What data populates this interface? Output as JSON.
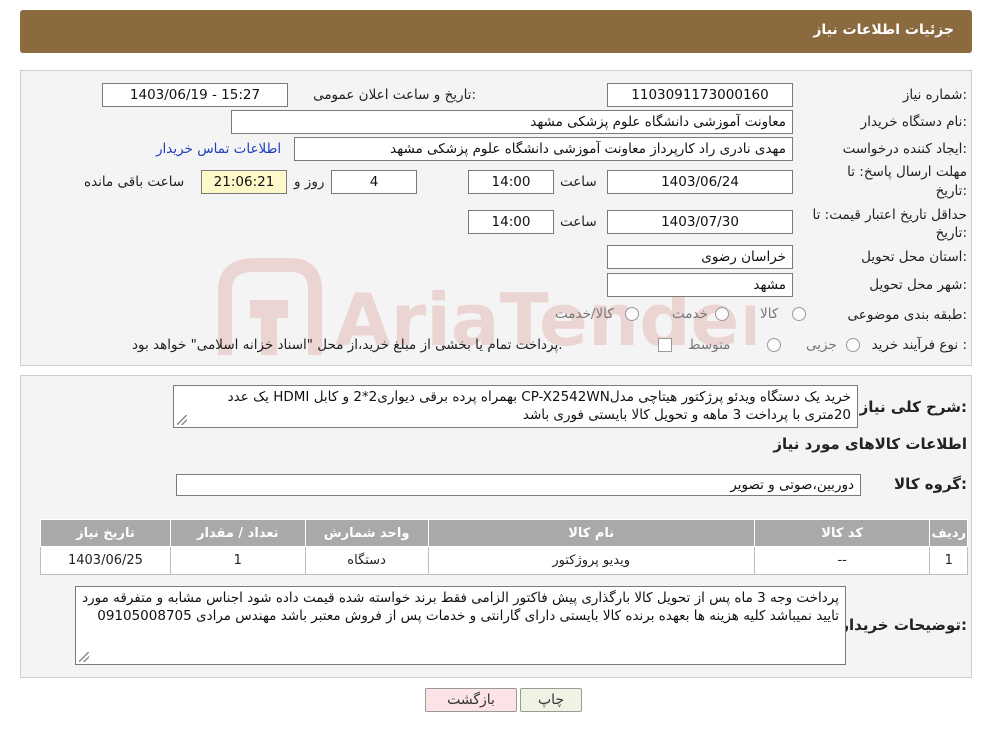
{
  "header": {
    "title": "جزئیات اطلاعات نیاز"
  },
  "form": {
    "need_number": {
      "label": "شماره نیاز:",
      "value": "1103091173000160"
    },
    "announce_datetime": {
      "label": "تاریخ و ساعت اعلان عمومی:",
      "value": "1403/06/19 - 15:27"
    },
    "buyer_org": {
      "label": "نام دستگاه خریدار:",
      "value": "معاونت آموزشی دانشگاه علوم پزشکی مشهد"
    },
    "requester": {
      "label": "ایجاد کننده درخواست:",
      "value": "مهدی نادری راد کارپرداز معاونت آموزشی دانشگاه علوم پزشکی مشهد",
      "contact_link": "اطلاعات تماس خریدار"
    },
    "reply_deadline": {
      "label_line1": "مهلت ارسال پاسخ: تا",
      "label_line2": "تاریخ:",
      "date": "1403/06/24",
      "time_label": "ساعت",
      "time": "14:00",
      "days": "4",
      "days_label": "روز و",
      "remaining": "21:06:21",
      "remaining_label": "ساعت باقی مانده"
    },
    "price_validity": {
      "label_line1": "حداقل تاریخ اعتبار قیمت: تا",
      "label_line2": "تاریخ:",
      "date": "1403/07/30",
      "time_label": "ساعت",
      "time": "14:00"
    },
    "province": {
      "label": "استان محل تحویل:",
      "value": "خراسان رضوی"
    },
    "city": {
      "label": "شهر محل تحویل:",
      "value": "مشهد"
    },
    "category": {
      "label": "طبقه بندی موضوعی:",
      "options": [
        "کالا",
        "خدمت",
        "کالا/خدمت"
      ]
    },
    "purchase_type": {
      "label": "نوع فرآیند خرید :",
      "options": [
        "جزیی",
        "متوسط"
      ],
      "note": "پرداخت تمام یا بخشی از مبلغ خرید،از محل \"اسناد خزانه اسلامی\" خواهد بود."
    }
  },
  "description": {
    "label": "شرح کلی نیاز:",
    "text": "خرید یک دستگاه ویدئو پرژکتور هیتاچی مدلCP-X2542WN  بهمراه پرده برقی دیواری2*2 و کابل HDMI یک عدد 20متری با پرداخت 3 ماهه و تحویل کالا بایستی فوری باشد"
  },
  "items_section": {
    "title": "اطلاعات کالاهای مورد نیاز"
  },
  "goods_group": {
    "label": "گروه کالا:",
    "value": "دوربین،صوتی و تصویر"
  },
  "table": {
    "headers": [
      "ردیف",
      "کد کالا",
      "نام کالا",
      "واحد شمارش",
      "تعداد / مقدار",
      "تاریخ نیاز"
    ],
    "rows": [
      {
        "row": "1",
        "code": "--",
        "name": "ویدیو پروژکتور",
        "unit": "دستگاه",
        "qty": "1",
        "date": "1403/06/25"
      }
    ]
  },
  "buyer_notes": {
    "label": "توضیحات خریدار:",
    "text": "پرداخت وجه 3 ماه پس از تحویل کالا بارگذاری پیش فاکتور الزامی فقط برند خواسته شده قیمت داده شود اجناس مشابه و متفرقه مورد تایید نمیباشد کلیه هزینه ها بعهده برنده کالا بایستی دارای گارانتی و خدمات پس از فروش معتبر باشد مهندس مرادی 09105008705"
  },
  "buttons": {
    "print": "چاپ",
    "back": "بازگشت"
  },
  "colors": {
    "header": "#8b6a40",
    "back_button": "#fbe3e6",
    "print_button": "#eef3e4",
    "remaining_bg": "#fff9c9"
  },
  "watermark": {
    "text": "AriaTender.neT"
  }
}
